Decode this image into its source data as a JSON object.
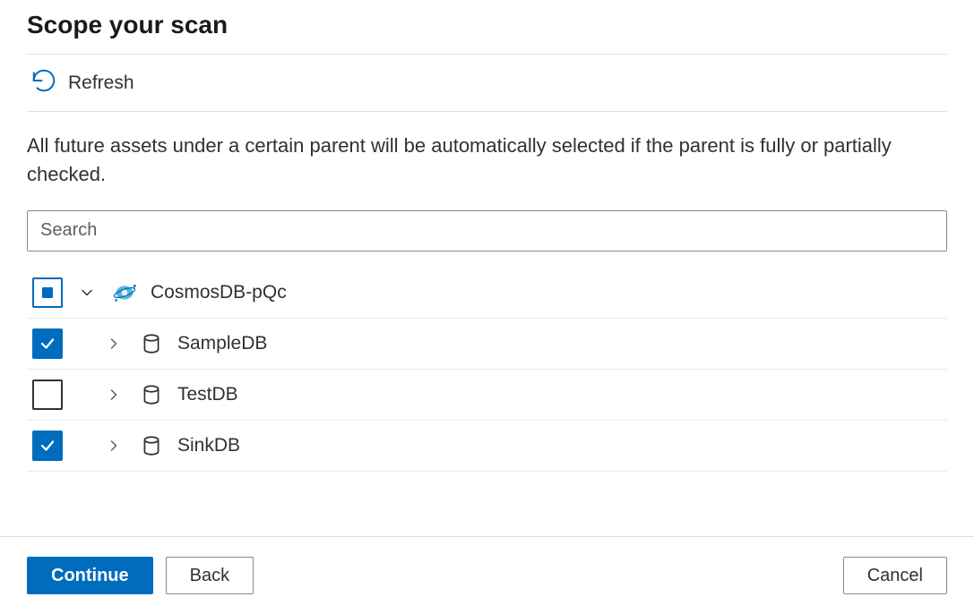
{
  "title": "Scope your scan",
  "commandBar": {
    "refresh": "Refresh"
  },
  "description": "All future assets under a certain parent will be automatically selected if the parent is fully or partially checked.",
  "search": {
    "placeholder": "Search"
  },
  "tree": {
    "root": {
      "label": "CosmosDB-pQc",
      "check_state": "indeterminate",
      "expanded": true,
      "icon": "cosmos-db-icon"
    },
    "children": [
      {
        "label": "SampleDB",
        "check_state": "checked",
        "expanded": false,
        "icon": "database-icon"
      },
      {
        "label": "TestDB",
        "check_state": "unchecked",
        "expanded": false,
        "icon": "database-icon"
      },
      {
        "label": "SinkDB",
        "check_state": "checked",
        "expanded": false,
        "icon": "database-icon"
      }
    ]
  },
  "buttons": {
    "continue": "Continue",
    "back": "Back",
    "cancel": "Cancel"
  },
  "colors": {
    "accent": "#006cbe"
  }
}
